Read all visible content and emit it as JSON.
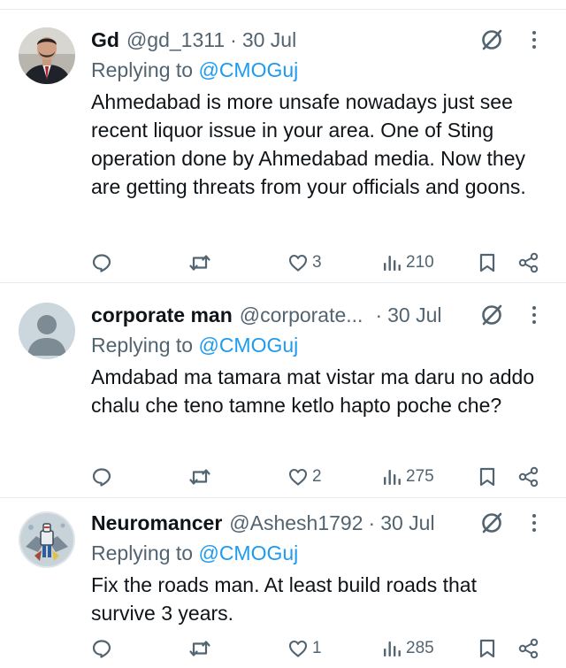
{
  "replies": [
    {
      "display_name": "Gd",
      "handle": "@gd_1311",
      "separator": "·",
      "date": "30 Jul",
      "replying_prefix": "Replying to",
      "replying_to": "@CMOGuj",
      "text": "Ahmedabad is more unsafe nowadays just see recent liquor issue in your area. One of Sting operation done by Ahmedabad media. Now they are getting threats from your officials and goons.",
      "replies_count": "",
      "retweets_count": "",
      "likes_count": "3",
      "views_count": "210",
      "avatar": "man-in-suit-photo"
    },
    {
      "display_name": "corporate man",
      "handle": "@corporate...",
      "separator": "·",
      "date": "30 Jul",
      "replying_prefix": "Replying to",
      "replying_to": "@CMOGuj",
      "text": "Amdabad ma tamara mat vistar ma daru no addo chalu che teno tamne ketlo hapto poche che?",
      "replies_count": "",
      "retweets_count": "",
      "likes_count": "2",
      "views_count": "275",
      "avatar": "default-user-silhouette"
    },
    {
      "display_name": "Neuromancer",
      "handle": "@Ashesh1792",
      "separator": "·",
      "date": "30 Jul",
      "replying_prefix": "Replying to",
      "replying_to": "@CMOGuj",
      "text": "Fix the roads man. At least build roads that survive 3 years.",
      "replies_count": "",
      "retweets_count": "",
      "likes_count": "1",
      "views_count": "285",
      "avatar": "mecha-robot-illustration"
    }
  ],
  "colors": {
    "text_primary": "#0f1419",
    "text_secondary": "#536471",
    "mention": "#1d9bf0",
    "divider": "#e6ecf0"
  },
  "icons": [
    "reply-icon",
    "retweet-icon",
    "like-icon",
    "views-icon",
    "bookmark-icon",
    "share-icon",
    "grok-icon",
    "more-icon"
  ]
}
